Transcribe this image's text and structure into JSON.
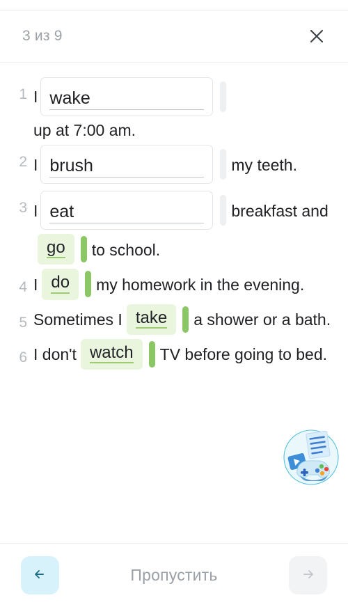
{
  "header": {
    "progress_label": "3 из 9",
    "close_icon": "close-icon"
  },
  "exercise": {
    "lines": [
      {
        "number": "1",
        "parts": [
          {
            "type": "text",
            "value": "I"
          },
          {
            "type": "input",
            "value": "wake"
          },
          {
            "type": "bar",
            "value": "gray"
          },
          {
            "type": "text",
            "value": "up at 7:00 am."
          }
        ]
      },
      {
        "number": "2",
        "parts": [
          {
            "type": "text",
            "value": "I"
          },
          {
            "type": "input",
            "value": "brush"
          },
          {
            "type": "bar",
            "value": "gray"
          },
          {
            "type": "text",
            "value": "my teeth."
          }
        ]
      },
      {
        "number": "3",
        "parts": [
          {
            "type": "text",
            "value": "I"
          },
          {
            "type": "input",
            "value": "eat"
          },
          {
            "type": "bar",
            "value": "gray"
          },
          {
            "type": "text",
            "value": "breakfast and"
          },
          {
            "type": "chip",
            "value": "go"
          },
          {
            "type": "bar",
            "value": "green"
          },
          {
            "type": "text",
            "value": "to school."
          }
        ]
      },
      {
        "number": "4",
        "parts": [
          {
            "type": "text",
            "value": "I"
          },
          {
            "type": "chip",
            "value": "do"
          },
          {
            "type": "bar",
            "value": "green"
          },
          {
            "type": "text",
            "value": "my homework in the evening."
          }
        ]
      },
      {
        "number": "5",
        "parts": [
          {
            "type": "text",
            "value": "Sometimes I"
          },
          {
            "type": "chip",
            "value": "take"
          },
          {
            "type": "bar",
            "value": "green"
          },
          {
            "type": "text",
            "value": "a shower or a bath."
          }
        ]
      },
      {
        "number": "6",
        "parts": [
          {
            "type": "text",
            "value": "I don't"
          },
          {
            "type": "chip",
            "value": "watch"
          },
          {
            "type": "bar",
            "value": "green"
          },
          {
            "type": "text",
            "value": "TV before going to bed."
          }
        ]
      }
    ]
  },
  "footer": {
    "prev_icon": "arrow-left-icon",
    "skip_label": "Пропустить",
    "next_icon": "arrow-right-icon"
  },
  "colors": {
    "chip_bg": "#eaf5de",
    "chip_underline": "#9ccb73",
    "bar_green": "#8cc765",
    "bar_gray": "#edeff1",
    "prev_btn_bg": "#d7f2fb",
    "next_btn_bg": "#f1f3f4",
    "muted_text": "#9aa0a6",
    "body_text": "#202124"
  }
}
